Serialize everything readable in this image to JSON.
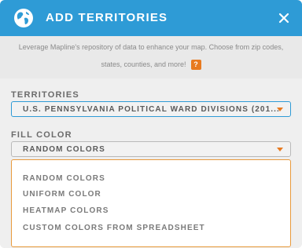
{
  "header": {
    "title": "ADD TERRITORIES",
    "background": "#2e9bd6",
    "icon": "globe-icon",
    "close_icon": "close-icon"
  },
  "description": {
    "line1": "Leverage Mapline's repository of data to enhance your map. Choose from zip codes,",
    "line2": "states, counties, and more!",
    "help_badge": "?",
    "help_badge_color": "#e87a20"
  },
  "territories": {
    "label": "TERRITORIES",
    "selected": "U.S. PENNSYLVANIA POLITICAL WARD DIVISIONS (201..."
  },
  "fill_color": {
    "label": "FILL COLOR",
    "selected": "RANDOM COLORS",
    "options": [
      "RANDOM COLORS",
      "UNIFORM COLOR",
      "HEATMAP COLORS",
      "CUSTOM COLORS FROM SPREADSHEET"
    ]
  },
  "colors": {
    "accent": "#e87a20",
    "focus_border": "#2e9bd6"
  }
}
